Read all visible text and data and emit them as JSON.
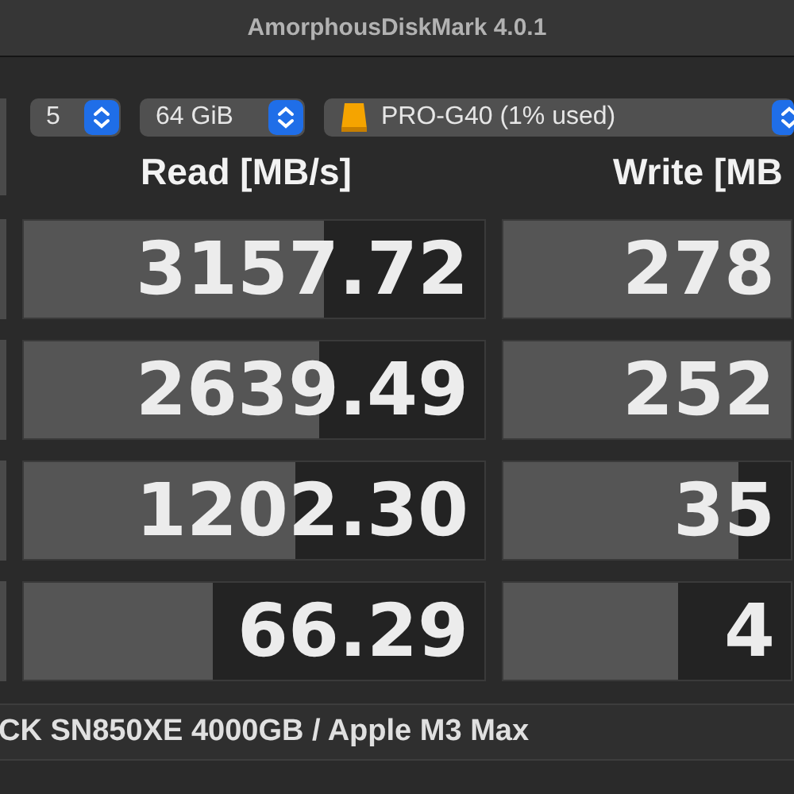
{
  "window": {
    "title": "AmorphousDiskMark 4.0.1"
  },
  "toolbar": {
    "selects": [
      {
        "kind": "count",
        "value": "5"
      },
      {
        "kind": "size",
        "value": "64 GiB"
      },
      {
        "kind": "drive",
        "value": "PRO-G40 (1% used)"
      }
    ]
  },
  "columns": [
    "Read [MB/s]",
    "Write [MB"
  ],
  "rows": [
    {
      "read": {
        "value": "3157.72",
        "level": 0.65
      },
      "write": {
        "value": "278",
        "level": 1
      }
    },
    {
      "read": {
        "value": "2639.49",
        "level": 0.64
      },
      "write": {
        "value": "252",
        "level": 1
      }
    },
    {
      "read": {
        "value": "1202.30",
        "level": 0.59
      },
      "write": {
        "value": "35",
        "level": 0.82
      }
    },
    {
      "read": {
        "value": "66.29",
        "level": 0.41
      },
      "write": {
        "value": "4",
        "level": 0.61
      }
    }
  ],
  "status_bar": {
    "text": "CK SN850XE 4000GB / Apple M3 Max"
  }
}
